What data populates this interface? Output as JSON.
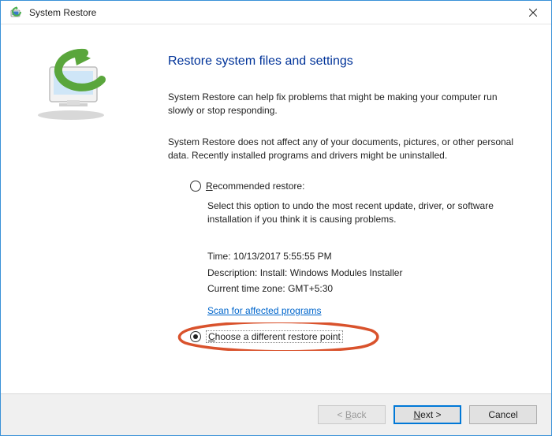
{
  "titlebar": {
    "title": "System Restore"
  },
  "content": {
    "heading": "Restore system files and settings",
    "para1": "System Restore can help fix problems that might be making your computer run slowly or stop responding.",
    "para2": "System Restore does not affect any of your documents, pictures, or other personal data. Recently installed programs and drivers might be uninstalled.",
    "option1": {
      "label": "Recommended restore:",
      "desc": "Select this option to undo the most recent update, driver, or software installation if you think it is causing problems.",
      "time_label": "Time:",
      "time_value": "10/13/2017 5:55:55 PM",
      "desc_label": "Description:",
      "desc_value": "Install: Windows Modules Installer",
      "tz_label": "Current time zone:",
      "tz_value": "GMT+5:30",
      "scan_link": "Scan for affected programs"
    },
    "option2": {
      "label": "Choose a different restore point"
    }
  },
  "footer": {
    "back": "< Back",
    "next": "Next >",
    "cancel": "Cancel"
  }
}
